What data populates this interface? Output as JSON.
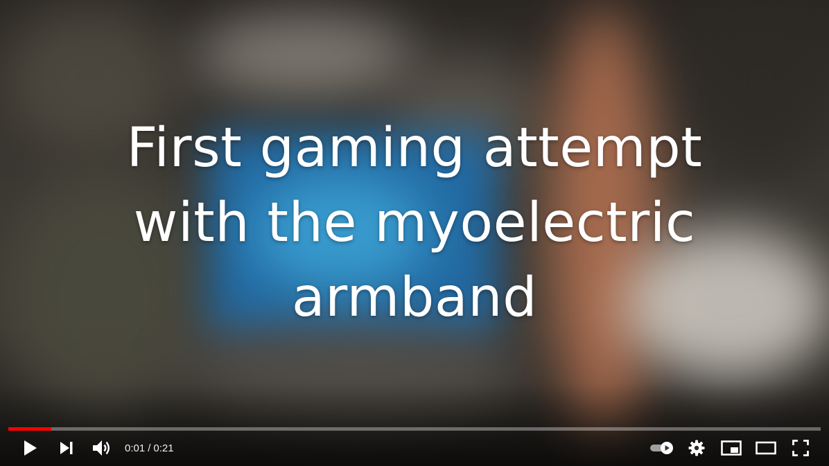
{
  "video": {
    "title_lines": [
      "First gaming attempt",
      "with the myoelectric",
      "armband"
    ]
  },
  "player": {
    "current_time": "0:01",
    "time_separator": "/",
    "duration": "0:21",
    "played_fraction": 0.053,
    "loaded_fraction": 0.053
  },
  "icons": {
    "play": "play-icon",
    "next": "next-icon",
    "volume": "volume-icon",
    "autoplay": "autoplay-toggle-icon",
    "settings": "gear-icon",
    "miniplayer": "miniplayer-icon",
    "theater": "theater-mode-icon",
    "fullscreen": "fullscreen-icon"
  },
  "colors": {
    "progress_played": "#ff0000",
    "control_icon": "#ffffff",
    "overlay_text": "#ffffff"
  }
}
